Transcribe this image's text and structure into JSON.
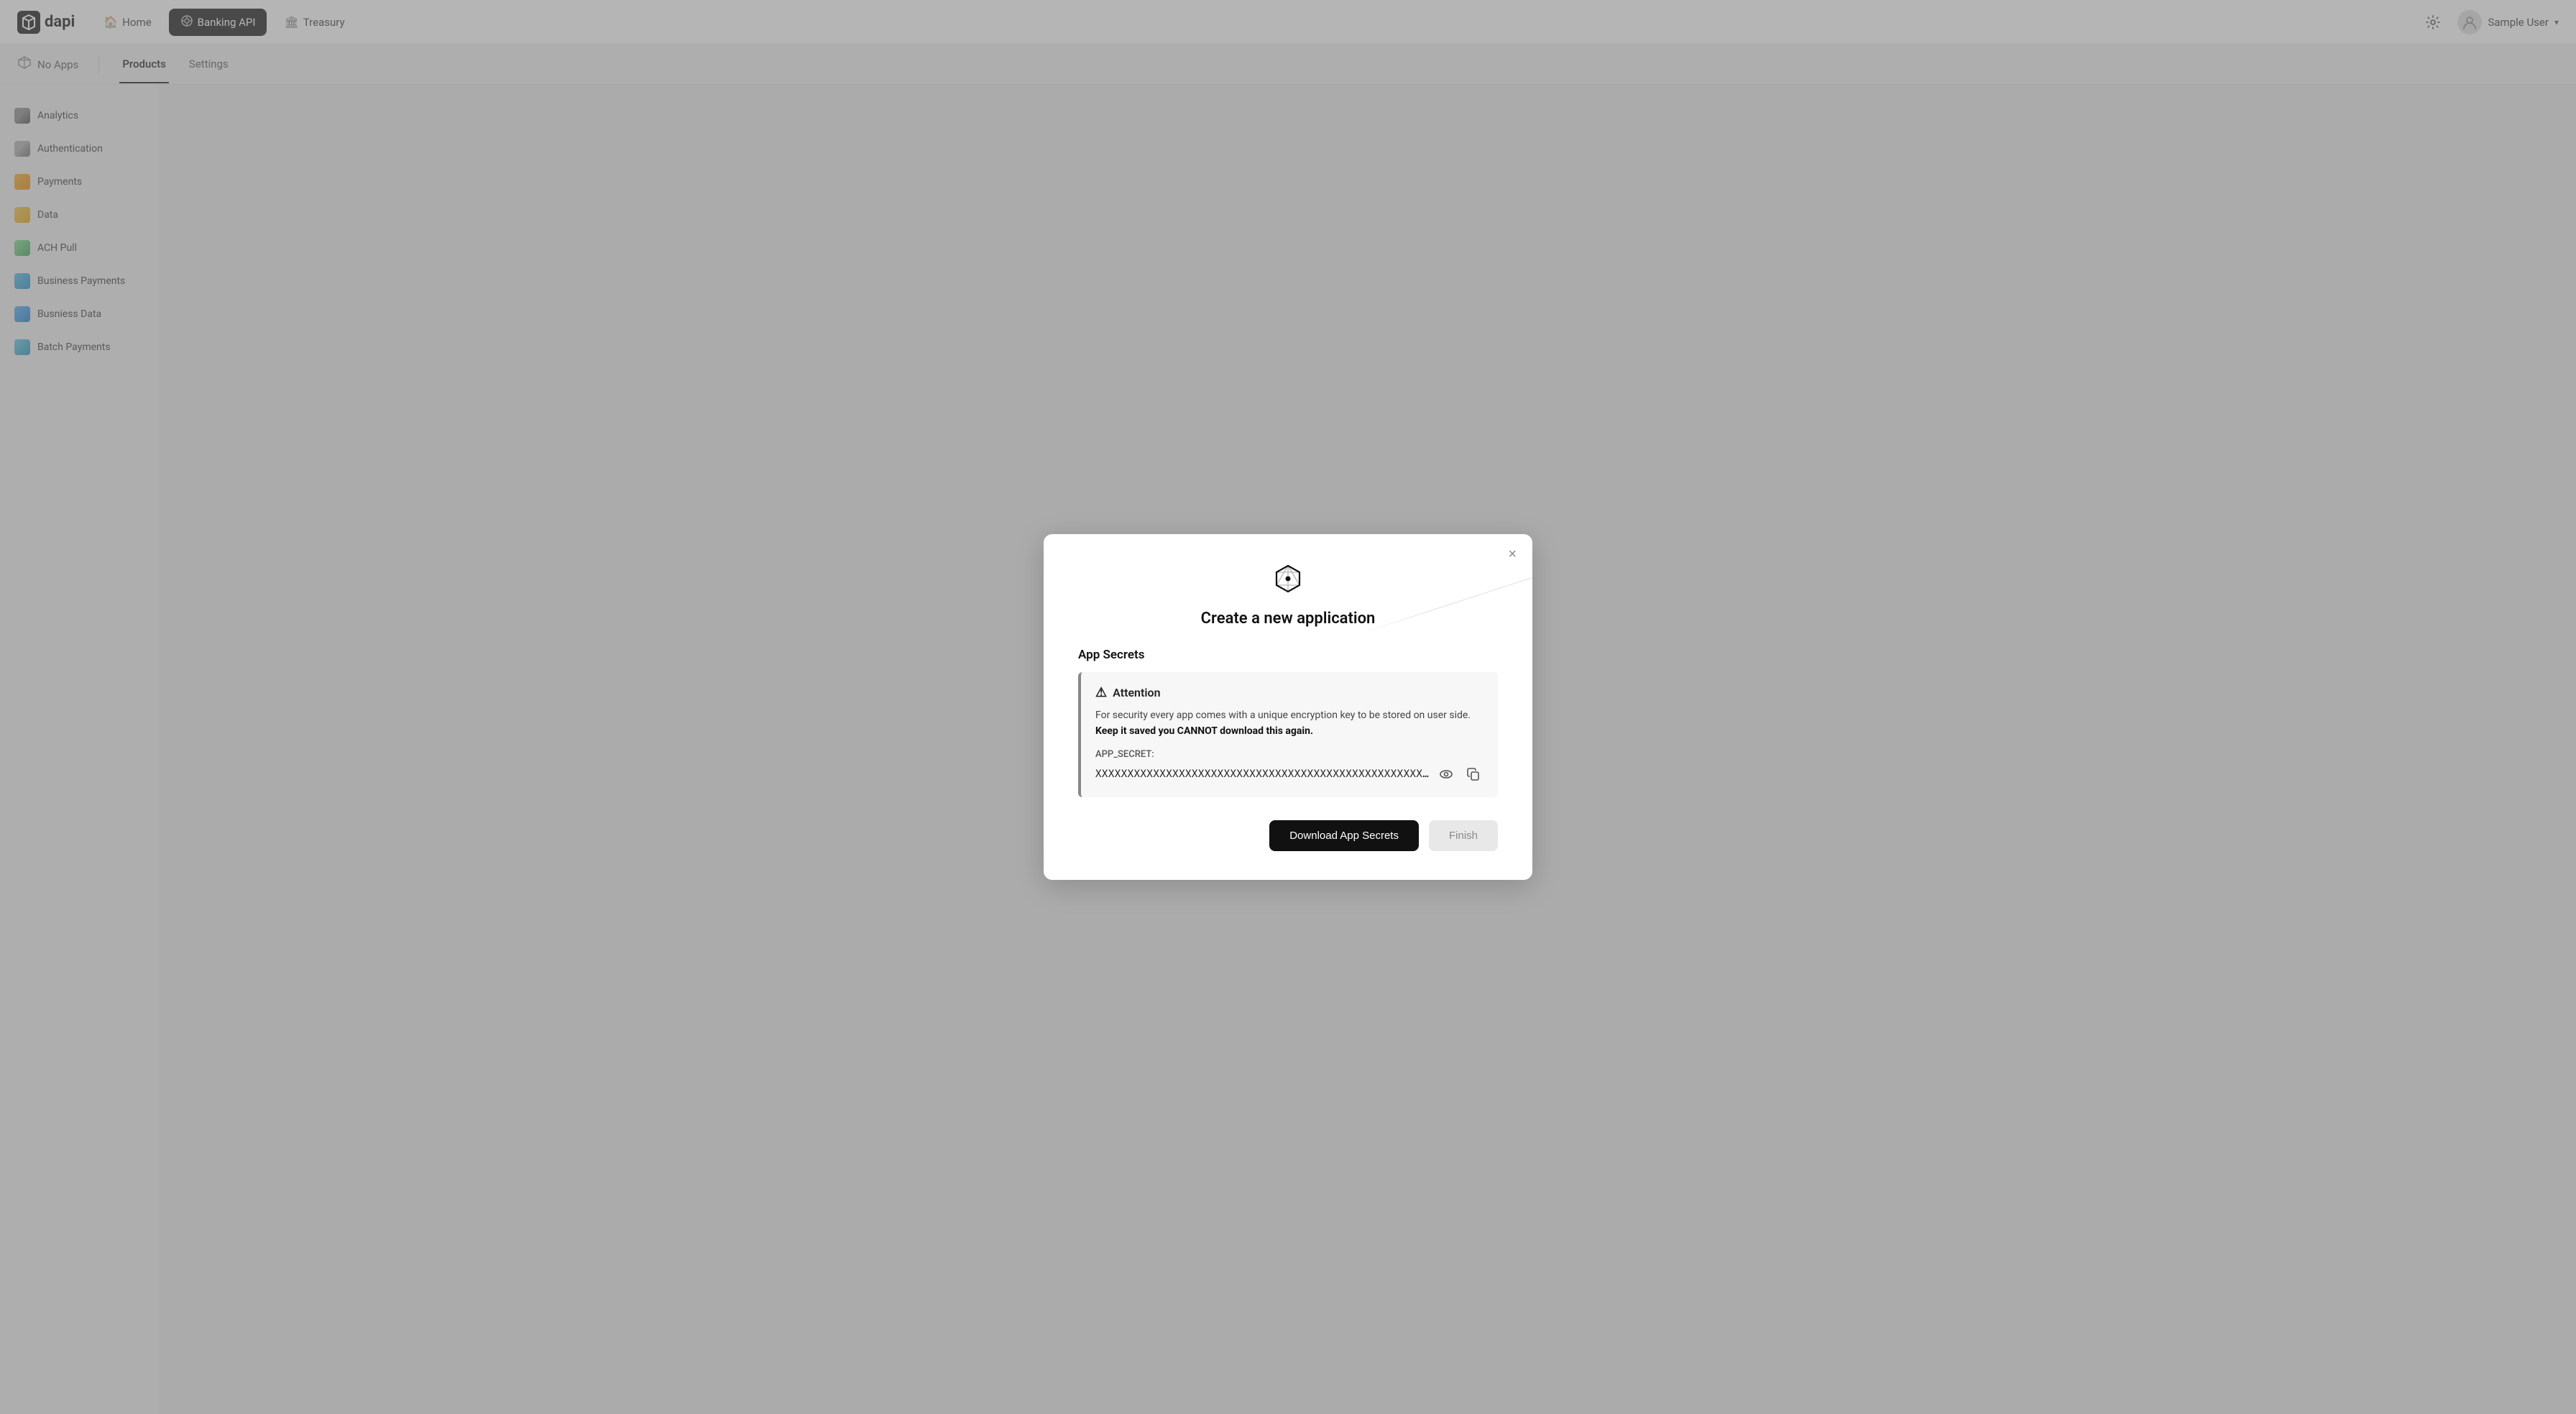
{
  "topnav": {
    "logo_text": "dapi",
    "nav_items": [
      {
        "id": "home",
        "label": "Home",
        "icon": "🏠",
        "active": false
      },
      {
        "id": "banking-api",
        "label": "Banking API",
        "icon": "⚙",
        "active": true
      },
      {
        "id": "treasury",
        "label": "Treasury",
        "icon": "🏛",
        "active": false
      }
    ],
    "settings_icon": "⚙",
    "user": {
      "name": "Sample User",
      "avatar_icon": "👤"
    }
  },
  "tabs_row": {
    "app_selector_label": "No Apps",
    "tabs": [
      {
        "id": "products",
        "label": "Products",
        "active": true
      },
      {
        "id": "settings",
        "label": "Settings",
        "active": false
      }
    ]
  },
  "sidebar": {
    "items": [
      {
        "id": "analytics",
        "label": "Analytics",
        "icon_class": "icon-analytics"
      },
      {
        "id": "authentication",
        "label": "Authentication",
        "icon_class": "icon-auth"
      },
      {
        "id": "payments",
        "label": "Payments",
        "icon_class": "icon-payments"
      },
      {
        "id": "data",
        "label": "Data",
        "icon_class": "icon-data"
      },
      {
        "id": "ach-pull",
        "label": "ACH Pull",
        "icon_class": "icon-ach"
      },
      {
        "id": "business-payments",
        "label": "Business Payments",
        "icon_class": "icon-bizpay"
      },
      {
        "id": "business-data",
        "label": "Busniess Data",
        "icon_class": "icon-bizdata"
      },
      {
        "id": "batch-payments",
        "label": "Batch Payments",
        "icon_class": "icon-batch"
      }
    ]
  },
  "modal": {
    "title": "Create a new application",
    "close_label": "×",
    "section_title": "App Secrets",
    "attention_title": "Attention",
    "attention_body_normal": "For security every app comes with a unique encryption key to be stored on user side.",
    "attention_body_bold": "Keep it saved you CANNOT download this again.",
    "secret_label": "APP_SECRET:",
    "secret_value": "XXXXXXXXXXXXXXXXXXXXXXXXXXXXXXXXXXXXXXXXXXXXXXXXXXXXXXX",
    "btn_download": "Download App Secrets",
    "btn_finish": "Finish"
  }
}
